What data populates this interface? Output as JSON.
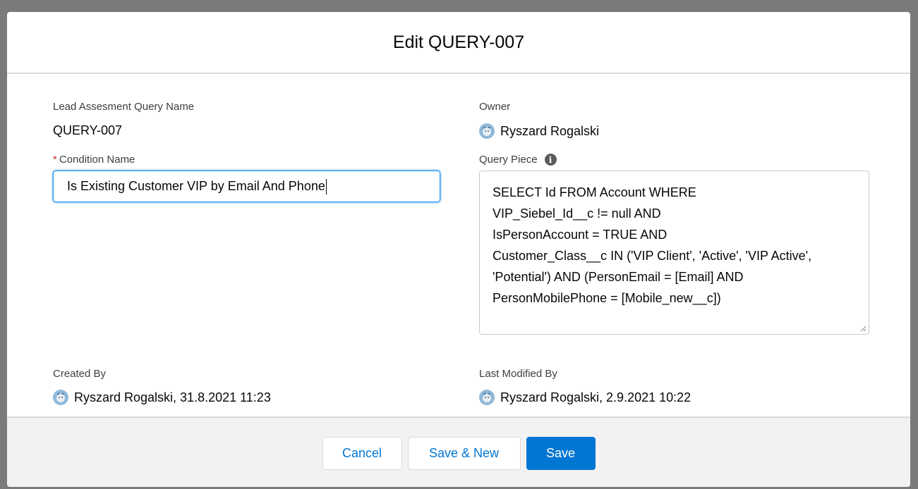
{
  "modal": {
    "title": "Edit QUERY-007"
  },
  "fields": {
    "query_name": {
      "label": "Lead Assesment Query Name",
      "value": "QUERY-007"
    },
    "owner": {
      "label": "Owner",
      "value": "Ryszard Rogalski"
    },
    "condition_name": {
      "required_marker": "*",
      "label": "Condition Name",
      "value": "Is Existing Customer VIP by Email And Phone"
    },
    "query_piece": {
      "label": "Query Piece",
      "info_icon": "info-icon",
      "lines": [
        "SELECT Id FROM Account WHERE",
        "VIP_Siebel_Id__c != null AND",
        "IsPersonAccount = TRUE AND",
        "Customer_Class__c IN ('VIP Client', 'Active', 'VIP Active',",
        "'Potential') AND (PersonEmail = [Email] AND",
        "PersonMobilePhone = [Mobile_new__c])"
      ]
    },
    "created_by": {
      "label": "Created By",
      "value": "Ryszard Rogalski, 31.8.2021 11:23"
    },
    "last_modified_by": {
      "label": "Last Modified By",
      "value": "Ryszard Rogalski, 2.9.2021 10:22"
    }
  },
  "footer": {
    "cancel_label": "Cancel",
    "save_new_label": "Save & New",
    "save_label": "Save"
  },
  "colors": {
    "brand": "#0176d3",
    "required": "#c23934",
    "footer_bg": "#f3f2f2"
  }
}
